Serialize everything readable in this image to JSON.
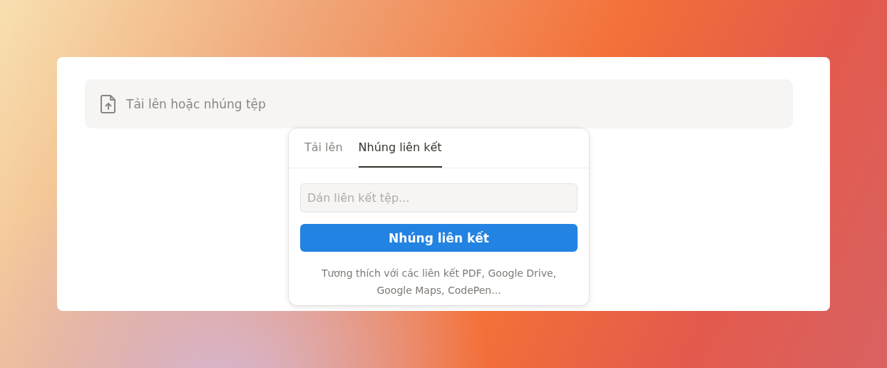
{
  "upload_bar": {
    "label": "Tải lên hoặc nhúng tệp"
  },
  "popover": {
    "tabs": [
      {
        "label": "Tải lên",
        "selected": false
      },
      {
        "label": "Nhúng liên kết",
        "selected": true
      }
    ],
    "link_field": {
      "placeholder": "Dán liên kết tệp..."
    },
    "button": "Nhúng liên kết",
    "hint": "Tương thích với các liên kết PDF, Google Drive, Google Maps, CodePen..."
  }
}
